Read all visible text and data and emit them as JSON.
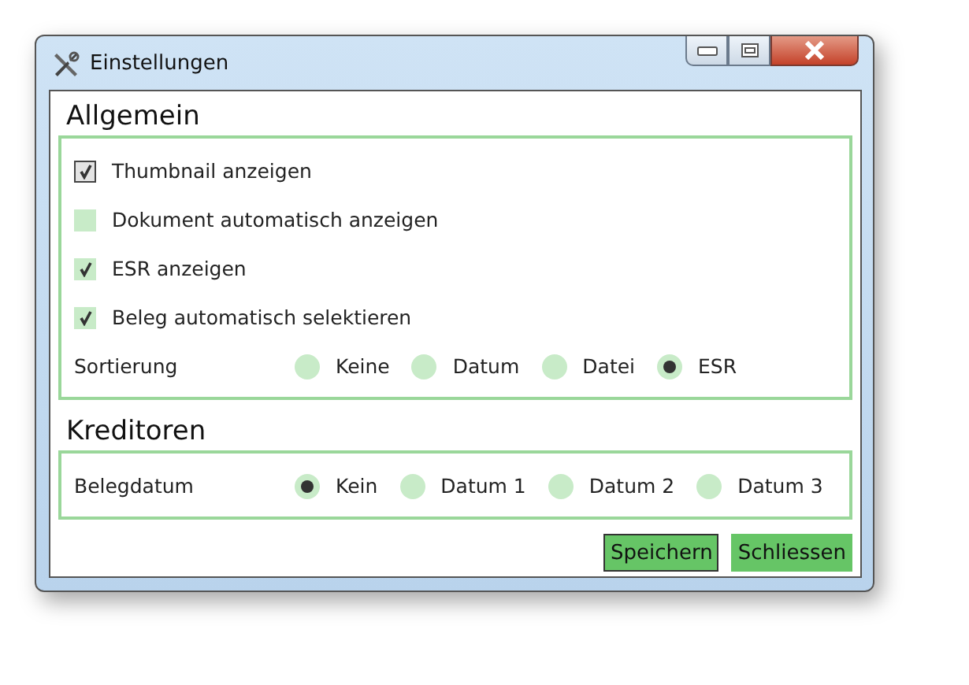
{
  "window": {
    "title": "Einstellungen"
  },
  "sections": [
    {
      "heading": "Allgemein",
      "rows": [
        {
          "kind": "checkbox",
          "label": "Thumbnail anzeigen",
          "checked": true,
          "focused": true
        },
        {
          "kind": "checkbox",
          "label": "Dokument automatisch anzeigen",
          "checked": false,
          "focused": false
        },
        {
          "kind": "checkbox",
          "label": "ESR anzeigen",
          "checked": true,
          "focused": false
        },
        {
          "kind": "checkbox",
          "label": "Beleg automatisch selektieren",
          "checked": true,
          "focused": false
        },
        {
          "kind": "radios",
          "label": "Sortierung",
          "options": [
            {
              "label": "Keine",
              "selected": false
            },
            {
              "label": "Datum",
              "selected": false
            },
            {
              "label": "Datei",
              "selected": false
            },
            {
              "label": "ESR",
              "selected": true
            }
          ]
        }
      ]
    },
    {
      "heading": "Kreditoren",
      "rows": [
        {
          "kind": "radios",
          "label": "Belegdatum",
          "options": [
            {
              "label": "Kein",
              "selected": true
            },
            {
              "label": "Datum 1",
              "selected": false
            },
            {
              "label": "Datum 2",
              "selected": false
            },
            {
              "label": "Datum 3",
              "selected": false
            }
          ]
        }
      ]
    }
  ],
  "buttons": [
    {
      "label": "Speichern",
      "focused": true
    },
    {
      "label": "Schliessen",
      "focused": false
    }
  ]
}
